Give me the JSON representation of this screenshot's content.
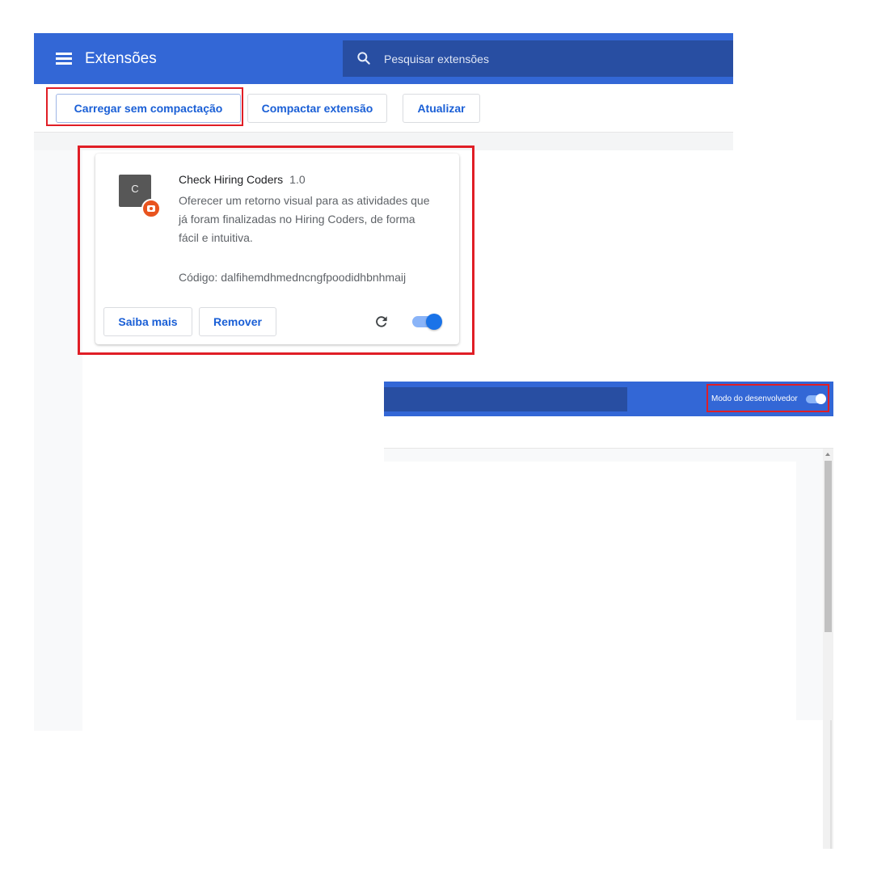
{
  "header": {
    "title": "Extensões",
    "search_placeholder": "Pesquisar extensões"
  },
  "toolbar": {
    "load_unpacked_label": "Carregar sem compactação",
    "pack_extension_label": "Compactar extensão",
    "update_label": "Atualizar"
  },
  "extension_card": {
    "icon_letter": "C",
    "name": "Check Hiring Coders",
    "version": "1.0",
    "description": "Oferecer um retorno visual para as atividades que já foram finalizadas no Hiring Coders, de forma fácil e intuitiva.",
    "id_label": "Código:",
    "id_value": "dalfihemdhmedncngfpoodidhbnhmaij",
    "details_label": "Saiba mais",
    "remove_label": "Remover",
    "enabled": true
  },
  "developer_bar": {
    "label": "Modo do desenvolvedor",
    "enabled": true
  },
  "colors": {
    "header_blue": "#3367d6",
    "search_blue": "#284ea2",
    "button_text_blue": "#1a5fd6",
    "highlight_red": "#e01e26",
    "toggle_blue": "#1a73e8",
    "badge_orange": "#e8541f"
  },
  "icons": [
    "menu-icon",
    "search-icon",
    "extension-icon",
    "reload-icon"
  ]
}
